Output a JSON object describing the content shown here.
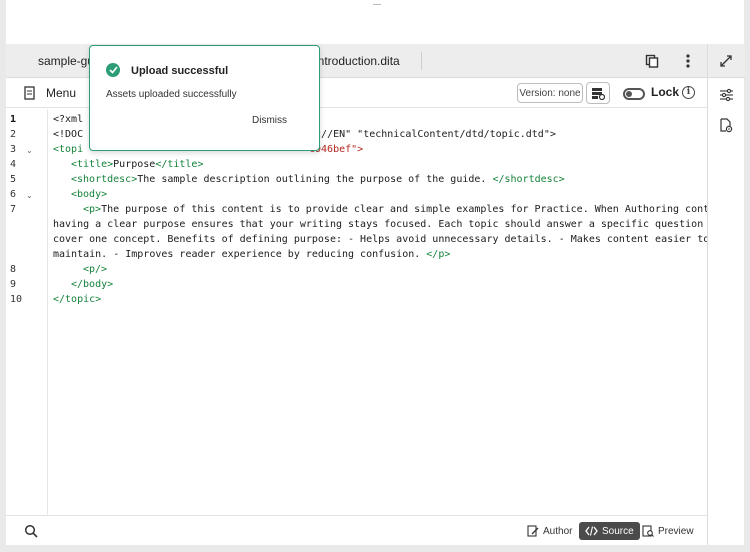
{
  "tabs": [
    {
      "label": "sample-gu"
    },
    {
      "label": "introduction.dita"
    }
  ],
  "toolbar": {
    "menu_label": "Menu",
    "version_label": "Version: none",
    "lock_label": "Lock"
  },
  "editor": {
    "line_numbers": [
      "1",
      "2",
      "3",
      "4",
      "5",
      "6",
      "7",
      "8",
      "9",
      "10"
    ],
    "lines": {
      "l1": "<?xml",
      "l2a": "<!DOC",
      "l2b": "pic//EN\" \"technicalContent/dtd/topic.dtd\">",
      "l3a": "<topi",
      "l3b": "c946bef\">",
      "l4_open": "<title>",
      "l4_text": "Purpose",
      "l4_close": "</title>",
      "l5_open": "<shortdesc>",
      "l5_text": "The sample description outlining the purpose of the guide. ",
      "l5_close": "</shortdesc>",
      "l6": "<body>",
      "l7_open": "<p>",
      "l7_text1": "The purpose of this content is to provide clear and simple examples for Practice. When Authoring content,",
      "l7_text2": "having a clear purpose ensures that your writing stays focused. Each topic should answer a specific question or",
      "l7_text3": "cover one concept. Benefits of defining purpose: - Helps avoid unnecessary details. - Makes content easier to",
      "l7_text4": "maintain. - Improves reader experience by reducing confusion. ",
      "l7_close": "</p>",
      "l8": "<p/>",
      "l9": "</body>",
      "l10": "</topic>"
    }
  },
  "bottom": {
    "author_label": "Author",
    "source_label": "Source",
    "preview_label": "Preview"
  },
  "toast": {
    "title": "Upload successful",
    "message": "Assets uploaded successfully",
    "dismiss_label": "Dismiss"
  },
  "colors": {
    "accent": "#2d9d78",
    "tag": "#15823a",
    "string": "#b3261e"
  }
}
